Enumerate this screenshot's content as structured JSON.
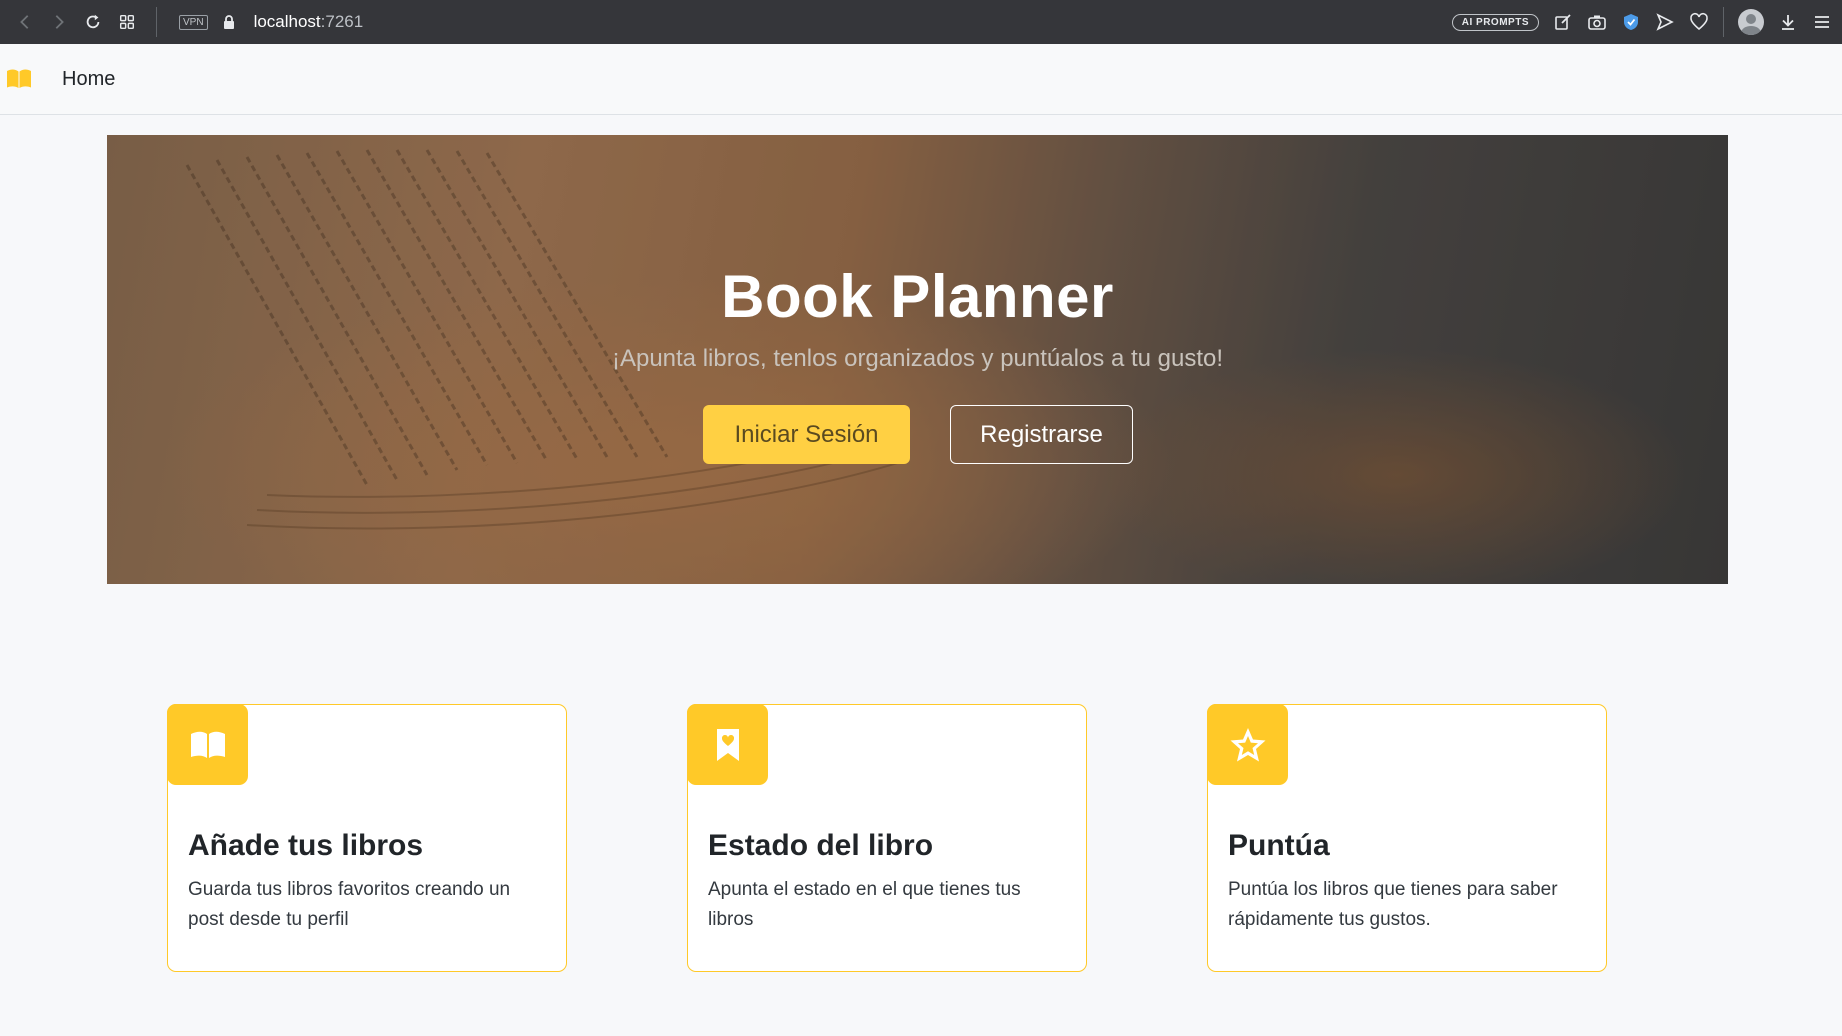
{
  "browser": {
    "url_host": "localhost",
    "url_port": ":7261",
    "vpn_label": "VPN",
    "ai_prompts_label": "AI PROMPTS",
    "icons": [
      "back-icon",
      "forward-icon",
      "reload-icon",
      "tabs-grid-icon",
      "lock-icon",
      "edit-icon",
      "camera-icon",
      "shield-icon",
      "send-icon",
      "heart-icon",
      "profile-icon",
      "download-icon",
      "menu-icon"
    ]
  },
  "navbar": {
    "brand_icon": "open-book-icon",
    "home_label": "Home",
    "accent_color": "#ffc928"
  },
  "hero": {
    "title": "Book Planner",
    "subtitle": "¡Apunta libros, tenlos organizados y puntúalos a tu gusto!",
    "login_label": "Iniciar Sesión",
    "register_label": "Registrarse",
    "login_color": "#ffd043"
  },
  "features": [
    {
      "icon": "book-icon",
      "title": "Añade tus libros",
      "text": "Guarda tus libros favoritos creando un post desde tu perfil"
    },
    {
      "icon": "bookmark-heart-icon",
      "title": "Estado del libro",
      "text": "Apunta el estado en el que tienes tus libros"
    },
    {
      "icon": "star-icon",
      "title": "Puntúa",
      "text": "Puntúa los libros que tienes para saber rápidamente tus gustos."
    }
  ]
}
